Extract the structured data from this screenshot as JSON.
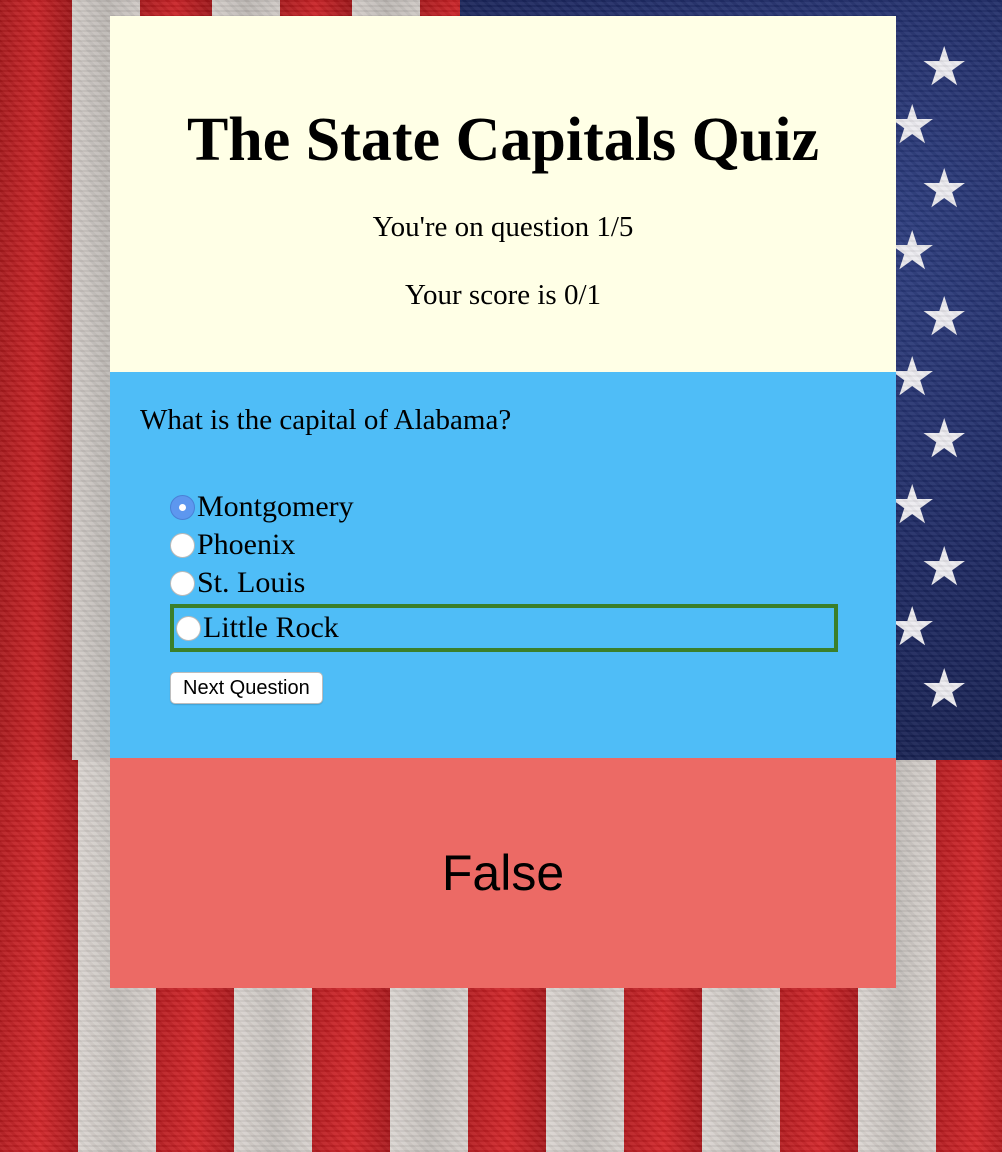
{
  "quiz": {
    "title": "The State Capitals Quiz",
    "progress_text": "You're on question 1/5",
    "score_text": "Your score is 0/1"
  },
  "question": {
    "text": "What is the capital of Alabama?",
    "options": [
      {
        "label": "Montgomery",
        "selected": true
      },
      {
        "label": "Phoenix",
        "selected": false
      },
      {
        "label": "St. Louis",
        "selected": false
      },
      {
        "label": "Little Rock",
        "selected": false,
        "highlighted": true
      }
    ],
    "next_button_label": "Next Question"
  },
  "result": {
    "text": "False"
  },
  "colors": {
    "header_bg": "#ffffe6",
    "question_bg": "#4fbdf7",
    "result_bg": "#ec6a65",
    "highlight_border": "#3b7f2a",
    "radio_checked": "#5d97ef"
  },
  "background": {
    "image": "american-flag"
  }
}
